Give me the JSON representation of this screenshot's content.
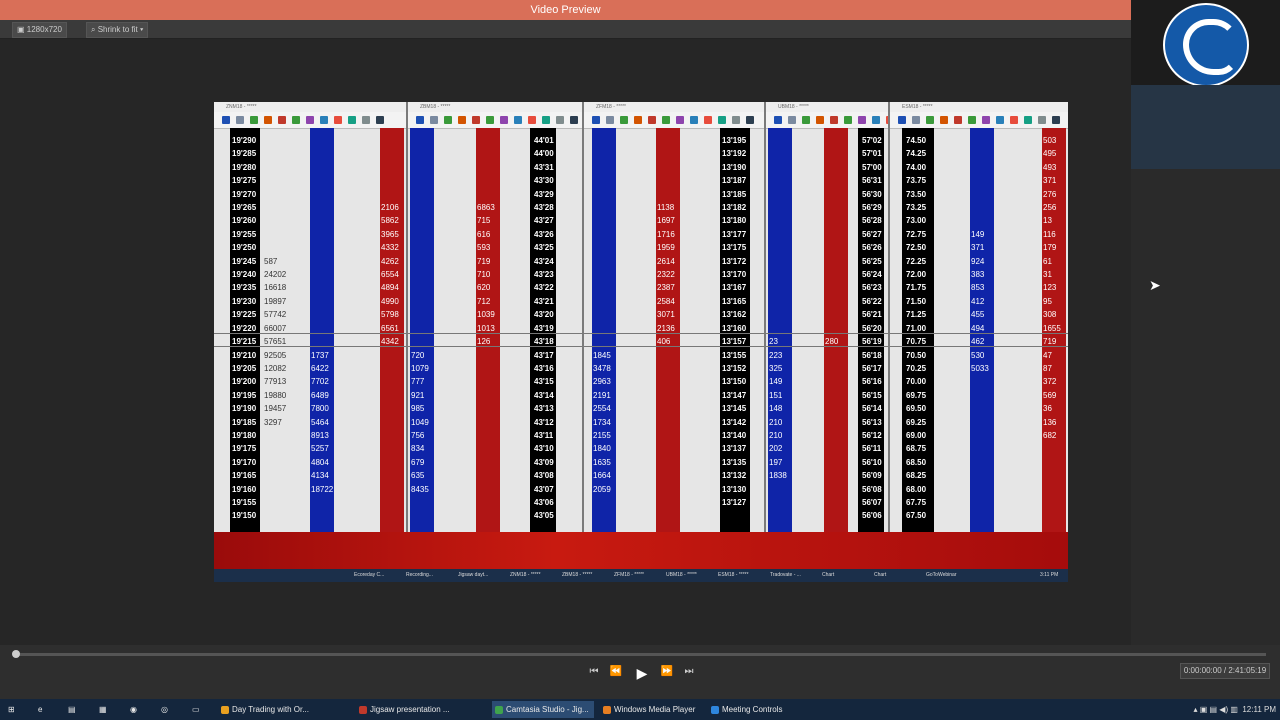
{
  "window": {
    "title": "Video Preview"
  },
  "toolbar": {
    "size_label": "1280x720",
    "zoom_label": "Shrink to fit"
  },
  "player": {
    "time": "0:00:00:00 / 2:41:05:19"
  },
  "taskbar": {
    "items": [
      {
        "label": "Day Trading with Or...",
        "color": "#e8a020"
      },
      {
        "label": "Jigsaw presentation ...",
        "color": "#c0392b"
      },
      {
        "label": "Camtasia Studio - Jig...",
        "color": "#3fa34d"
      },
      {
        "label": "Windows Media Player",
        "color": "#e67e22"
      },
      {
        "label": "Meeting Controls",
        "color": "#2e86de"
      }
    ],
    "clock": "12:11 PM"
  },
  "inner_taskbar": {
    "items": [
      "Ecoreday C...",
      "Recording...",
      "Jigsaw dayt...",
      "ZNM18 - *****",
      "ZBM18 - *****",
      "ZFM18 - *****",
      "UBM18 - *****",
      "ESM18 - *****",
      "Tradovate - ...",
      "Chart",
      "Chart",
      "GoToWebinar"
    ],
    "clock": "3:11 PM"
  },
  "ladders": [
    {
      "title": "ZNM18 - *****",
      "prices": [
        "19'290",
        "19'285",
        "19'280",
        "19'275",
        "19'270",
        "19'265",
        "19'260",
        "19'255",
        "19'250",
        "19'245",
        "19'240",
        "19'235",
        "19'230",
        "19'225",
        "19'220",
        "19'215",
        "19'210",
        "19'205",
        "19'200",
        "19'195",
        "19'190",
        "19'185",
        "19'180",
        "19'175",
        "19'170",
        "19'165",
        "19'160",
        "19'155",
        "19'150"
      ],
      "vol": [
        "",
        "",
        "",
        "",
        "",
        "",
        "",
        "",
        "",
        "587",
        "24202",
        "16618",
        "19897",
        "57742",
        "66007",
        "57651",
        "92505",
        "12082",
        "77913",
        "19880",
        "19457",
        "3297",
        "",
        "",
        "",
        "",
        "",
        "",
        ""
      ],
      "bid": [
        "",
        "",
        "",
        "",
        "",
        "",
        "",
        "",
        "",
        "",
        "",
        "",
        "",
        "",
        "",
        "",
        "1737",
        "6422",
        "7702",
        "6489",
        "7800",
        "5464",
        "8913",
        "5257",
        "4804",
        "4134",
        "18722",
        "",
        ""
      ],
      "ask": [
        "",
        "",
        "",
        "",
        "",
        "2106",
        "5862",
        "3965",
        "4332",
        "4262",
        "6554",
        "4894",
        "4990",
        "5798",
        "6561",
        "4342",
        "",
        "",
        "",
        "",
        "",
        "",
        "",
        "",
        "",
        "",
        "",
        "",
        ""
      ]
    },
    {
      "title": "ZBM18 - *****",
      "prices": [
        "44'01",
        "44'00",
        "43'31",
        "43'30",
        "43'29",
        "43'28",
        "43'27",
        "43'26",
        "43'25",
        "43'24",
        "43'23",
        "43'22",
        "43'21",
        "43'20",
        "43'19",
        "43'18",
        "43'17",
        "43'16",
        "43'15",
        "43'14",
        "43'13",
        "43'12",
        "43'11",
        "43'10",
        "43'09",
        "43'08",
        "43'07",
        "43'06",
        "43'05"
      ],
      "bid": [
        "",
        "",
        "",
        "",
        "",
        "",
        "",
        "",
        "",
        "",
        "",
        "",
        "",
        "",
        "",
        "",
        "720",
        "1079",
        "777",
        "921",
        "985",
        "1049",
        "756",
        "834",
        "679",
        "635",
        "8435",
        "",
        ""
      ],
      "ask": [
        "",
        "",
        "",
        "",
        "",
        "6863",
        "715",
        "616",
        "593",
        "719",
        "710",
        "620",
        "712",
        "1039",
        "1013",
        "126",
        "",
        "",
        "",
        "",
        "",
        "",
        "",
        "",
        "",
        "",
        "",
        "",
        ""
      ]
    },
    {
      "title": "ZFM18 - *****",
      "prices": [
        "13'195",
        "13'192",
        "13'190",
        "13'187",
        "13'185",
        "13'182",
        "13'180",
        "13'177",
        "13'175",
        "13'172",
        "13'170",
        "13'167",
        "13'165",
        "13'162",
        "13'160",
        "13'157",
        "13'155",
        "13'152",
        "13'150",
        "13'147",
        "13'145",
        "13'142",
        "13'140",
        "13'137",
        "13'135",
        "13'132",
        "13'130",
        "13'127",
        ""
      ],
      "bid": [
        "",
        "",
        "",
        "",
        "",
        "",
        "",
        "",
        "",
        "",
        "",
        "",
        "",
        "",
        "",
        "",
        "1845",
        "3478",
        "2963",
        "2191",
        "2554",
        "1734",
        "2155",
        "1840",
        "1635",
        "1664",
        "2059",
        "",
        ""
      ],
      "ask": [
        "",
        "",
        "",
        "",
        "",
        "1138",
        "1697",
        "1716",
        "1959",
        "2614",
        "2322",
        "2387",
        "2584",
        "3071",
        "2136",
        "406",
        "",
        "",
        "",
        "",
        "",
        "",
        "",
        "",
        "",
        "",
        "",
        "",
        ""
      ]
    },
    {
      "title": "UBM18 - *****",
      "prices": [
        "57'02",
        "57'01",
        "57'00",
        "56'31",
        "56'30",
        "56'29",
        "56'28",
        "56'27",
        "56'26",
        "56'25",
        "56'24",
        "56'23",
        "56'22",
        "56'21",
        "56'20",
        "56'19",
        "56'18",
        "56'17",
        "56'16",
        "56'15",
        "56'14",
        "56'13",
        "56'12",
        "56'11",
        "56'10",
        "56'09",
        "56'08",
        "56'07",
        "56'06"
      ],
      "bid": [
        "",
        "",
        "",
        "",
        "",
        "",
        "",
        "",
        "",
        "",
        "",
        "",
        "",
        "",
        "",
        "23",
        "223",
        "325",
        "149",
        "151",
        "148",
        "210",
        "210",
        "202",
        "197",
        "1838",
        "",
        "",
        ""
      ],
      "ask": [
        "",
        "",
        "",
        "",
        "",
        "",
        "",
        "",
        "",
        "",
        "",
        "",
        "",
        "",
        "",
        "280",
        "",
        "",
        "",
        "",
        "",
        "",
        "",
        "",
        "",
        "",
        "",
        "",
        ""
      ]
    },
    {
      "title": "ESM18 - *****",
      "prices": [
        "74.50",
        "74.25",
        "74.00",
        "73.75",
        "73.50",
        "73.25",
        "73.00",
        "72.75",
        "72.50",
        "72.25",
        "72.00",
        "71.75",
        "71.50",
        "71.25",
        "71.00",
        "70.75",
        "70.50",
        "70.25",
        "70.00",
        "69.75",
        "69.50",
        "69.25",
        "69.00",
        "68.75",
        "68.50",
        "68.25",
        "68.00",
        "67.75",
        "67.50"
      ],
      "bid": [
        "",
        "",
        "",
        "",
        "",
        "",
        "",
        "149",
        "371",
        "924",
        "383",
        "853",
        "412",
        "455",
        "494",
        "462",
        "530",
        "5033",
        "",
        "",
        "",
        "",
        "",
        "",
        "",
        "",
        "",
        "",
        ""
      ],
      "ask": [
        "503",
        "495",
        "493",
        "371",
        "276",
        "256",
        "13",
        "116",
        "179",
        "61",
        "31",
        "123",
        "95",
        "308",
        "1655",
        "719",
        "47",
        "87",
        "372",
        "569",
        "36",
        "136",
        "682",
        "",
        "",
        "",
        "",
        "",
        ""
      ]
    }
  ]
}
